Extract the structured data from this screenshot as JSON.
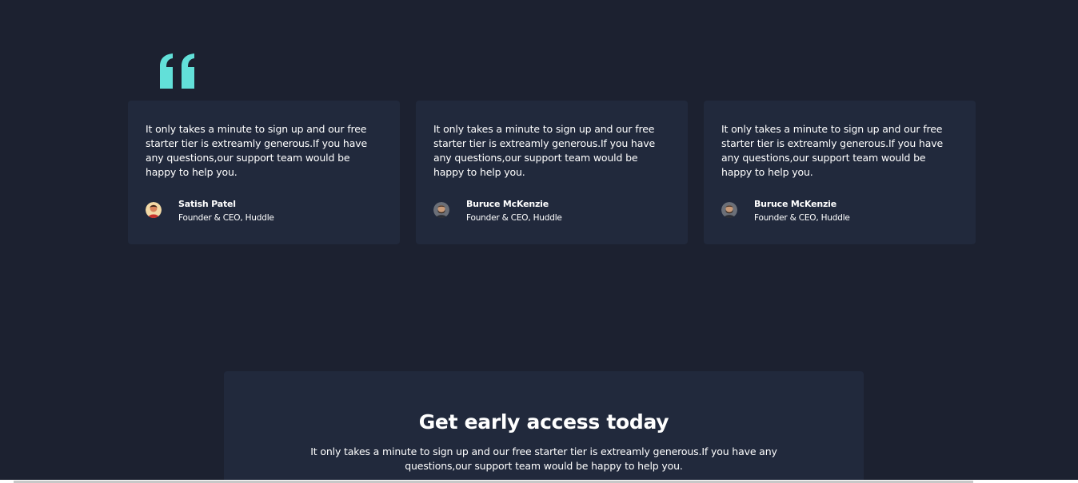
{
  "colors": {
    "background": "#1c2130",
    "card": "#21293c",
    "accent": "#62e0d9",
    "text": "#ffffff"
  },
  "quote_icon": "quote-mark-icon",
  "testimonials": [
    {
      "text": "It only takes a minute to sign up and our free starter tier is extreamly generous.If you have any questions,our support team would be happy to help you.",
      "name": "Satish Patel",
      "role": "Founder & CEO, Huddle",
      "avatar_icon": "avatar-satish"
    },
    {
      "text": "It only takes a minute to sign up and our free starter tier is extreamly generous.If you have any questions,our support team would be happy to help you.",
      "name": "Buruce McKenzie",
      "role": "Founder & CEO, Huddle",
      "avatar_icon": "avatar-bruce"
    },
    {
      "text": "It only takes a minute to sign up and our free starter tier is extreamly generous.If you have any questions,our support team would be happy to help you.",
      "name": "Buruce McKenzie",
      "role": "Founder & CEO, Huddle",
      "avatar_icon": "avatar-bruce"
    }
  ],
  "cta": {
    "title": "Get early access today",
    "text": "It only takes a minute to sign up and our free starter tier is extreamly generous.If you have any questions,our support team would be happy to help you."
  }
}
